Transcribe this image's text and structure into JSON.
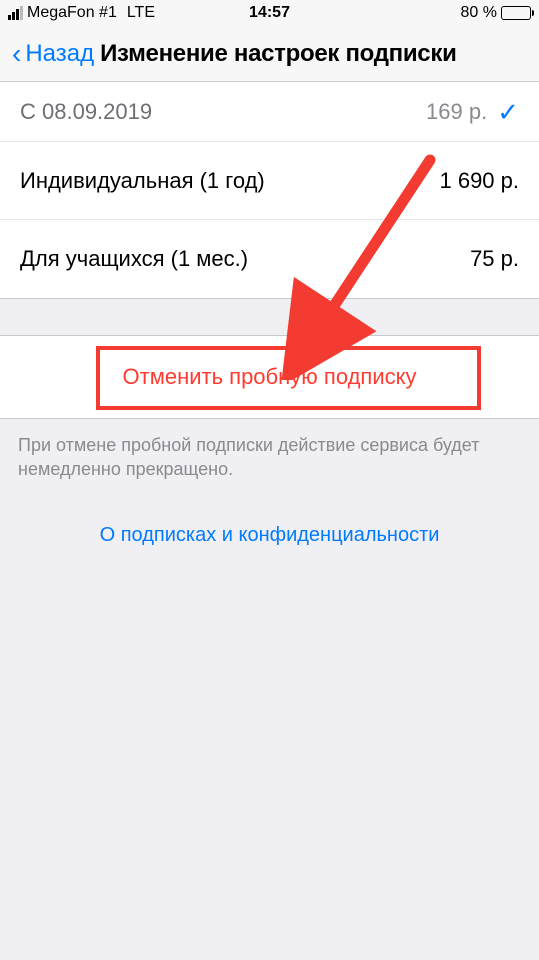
{
  "status": {
    "carrier": "MegaFon #1",
    "network": "LTE",
    "time": "14:57",
    "battery_pct": "80 %"
  },
  "nav": {
    "back": "Назад",
    "title": "Изменение настроек подписки"
  },
  "current": {
    "since_label": "С 08.09.2019",
    "price": "169 р."
  },
  "options": [
    {
      "label": "Индивидуальная (1 год)",
      "price": "1 690 р."
    },
    {
      "label": "Для учащихся (1 мес.)",
      "price": "75 р."
    }
  ],
  "cancel": {
    "label": "Отменить пробную подписку"
  },
  "footnote": "При отмене пробной подписки действие сервиса будет немедленно прекращено.",
  "privacy_link": "О подписках и конфиденциальности",
  "colors": {
    "accent": "#007aff",
    "destructive": "#ff3b30",
    "annotation": "#f33b32"
  }
}
